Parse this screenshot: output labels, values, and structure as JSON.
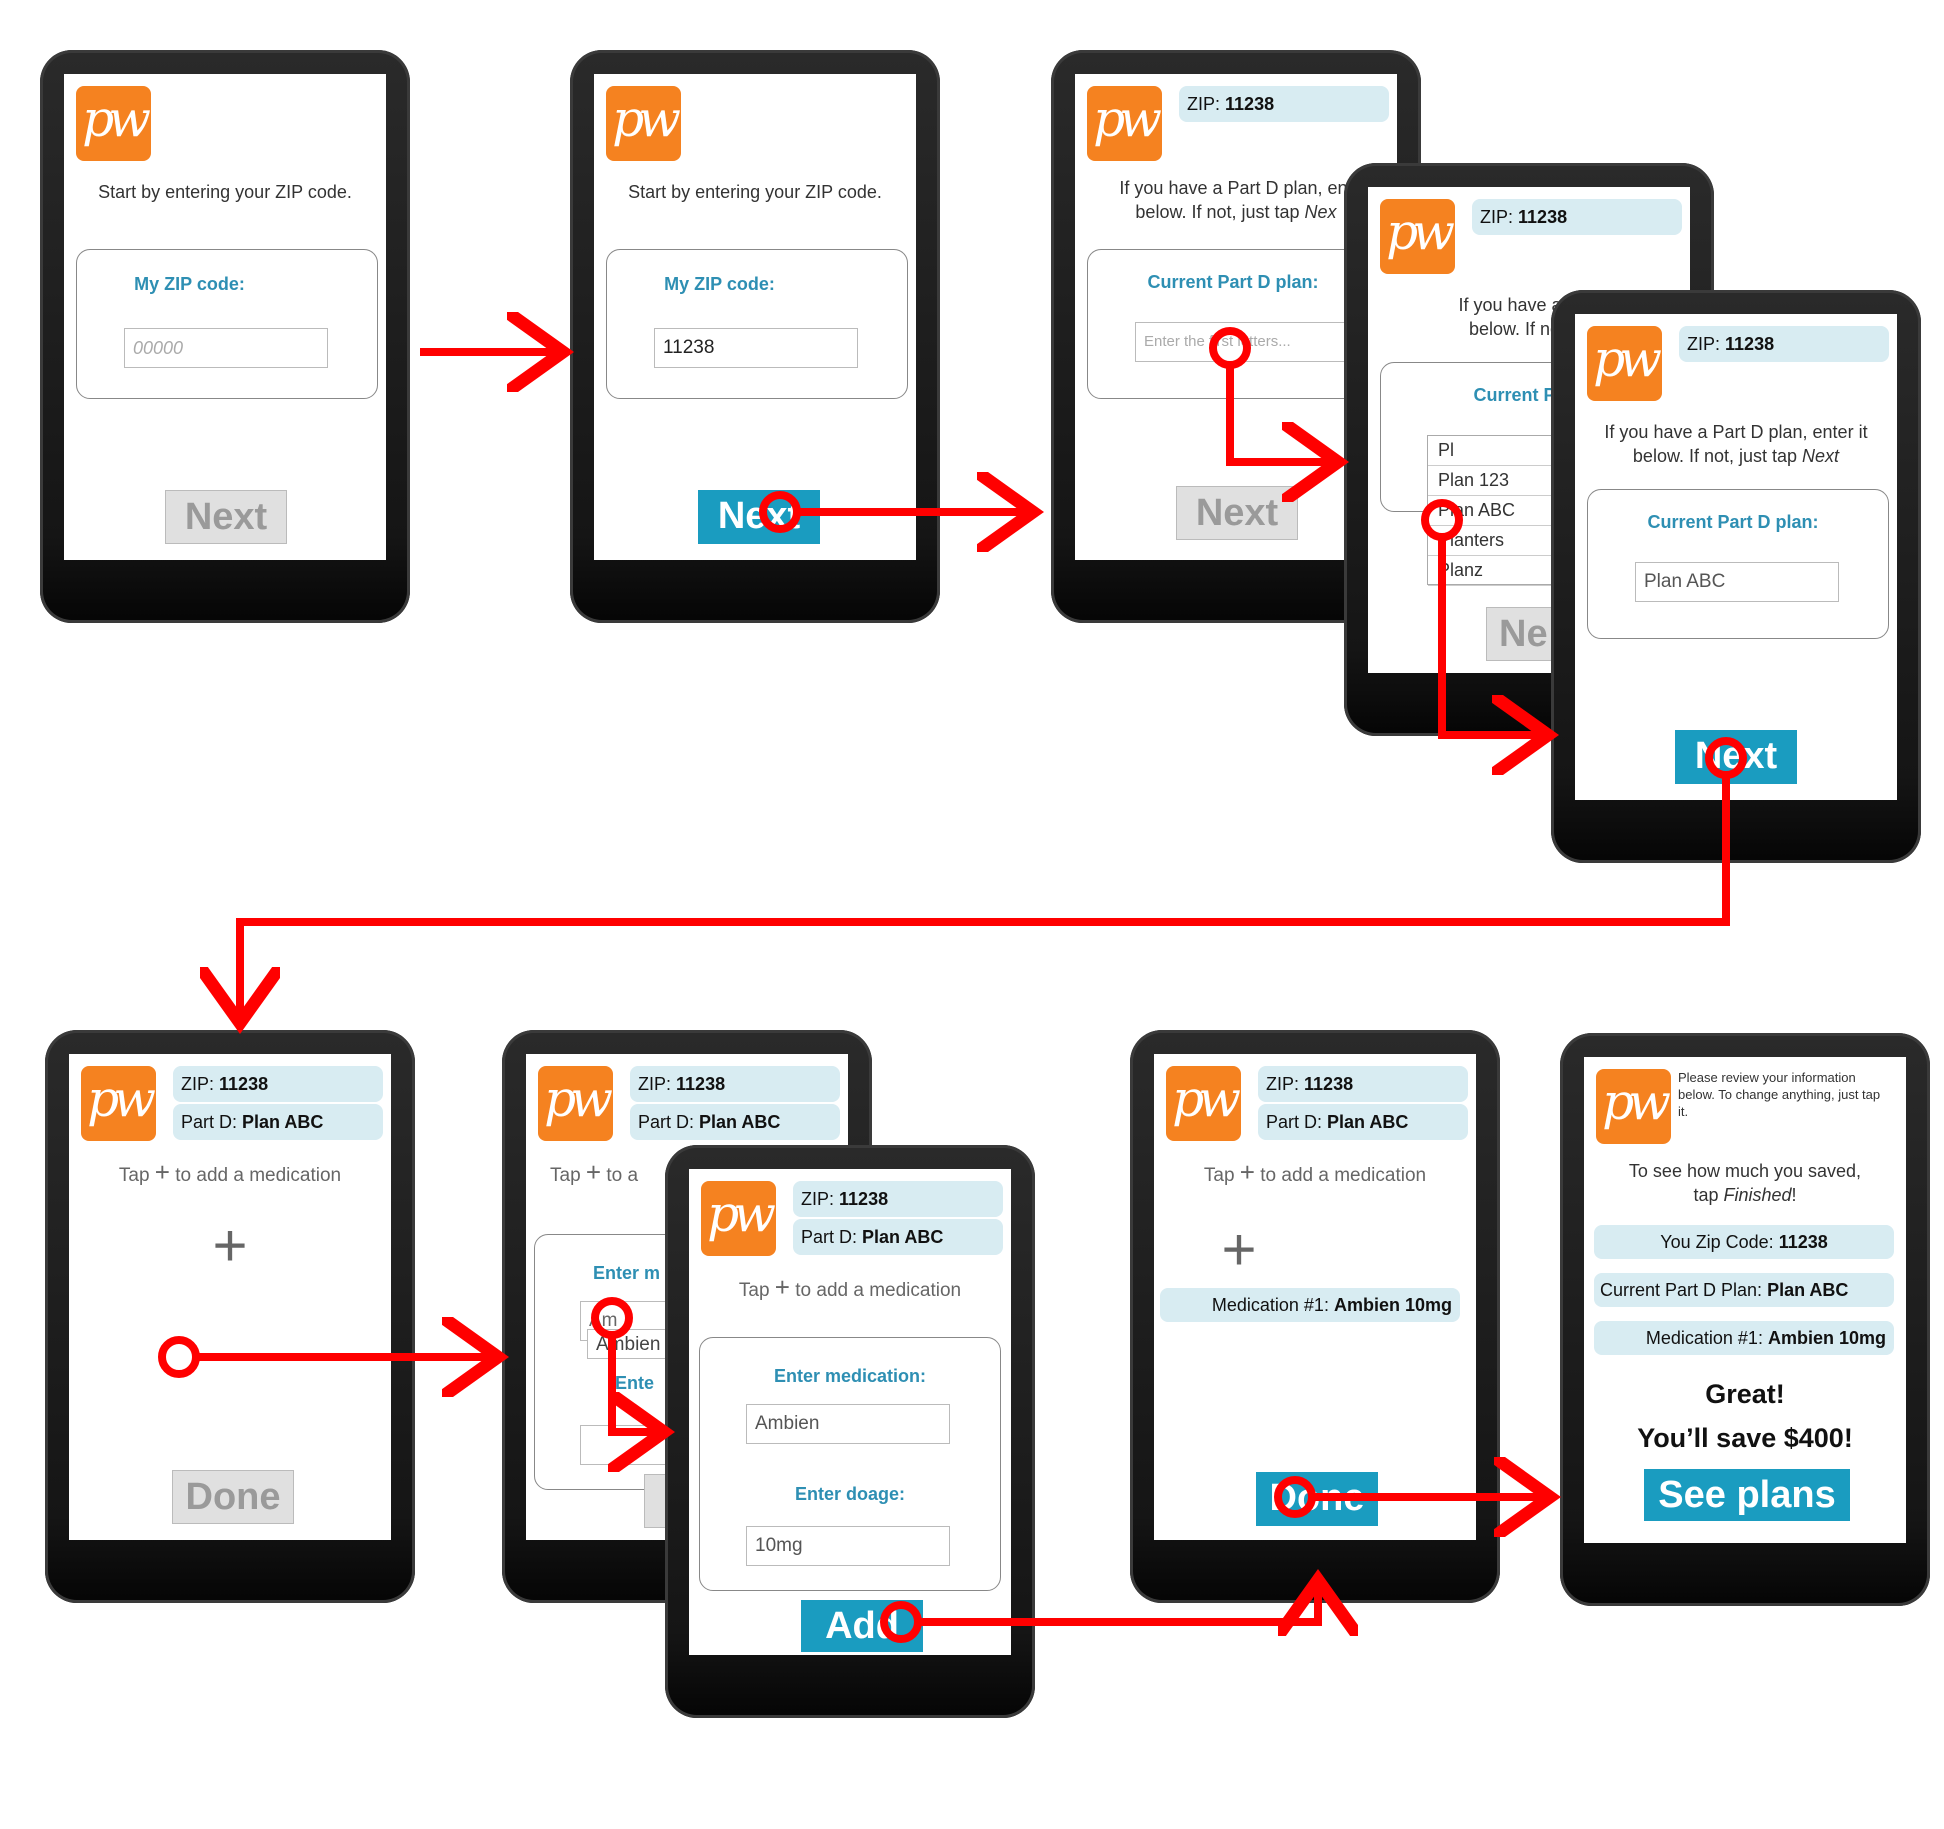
{
  "logo_text": "pw",
  "colors": {
    "accent": "#1a9cc0",
    "logo": "#f58220",
    "arrow": "#ff0000",
    "label": "#2e8fb3"
  },
  "s1": {
    "intro": "Start by entering your ZIP code.",
    "label": "My ZIP code:",
    "placeholder": "00000",
    "button": "Next"
  },
  "s2": {
    "intro": "Start by entering your ZIP code.",
    "label": "My ZIP code:",
    "value": "11238",
    "button": "Next"
  },
  "s3": {
    "zip_label": "ZIP:",
    "zip": "11238",
    "intro_line1": "If you have a Part D plan, ent",
    "intro_line2": "below. If not, just tap",
    "intro_next": "Nex",
    "label": "Current Part D plan:",
    "placeholder": "Enter the first letters...",
    "button": "Next"
  },
  "s4": {
    "zip_label": "ZIP:",
    "zip": "11238",
    "intro_line1": "If you have a Part",
    "intro_line2": "below. If not, ju",
    "label": "Current Part",
    "options": [
      "Pl",
      "Plan 123",
      "Plan ABC",
      "Planters",
      "Planz"
    ],
    "button": "Ne"
  },
  "s5": {
    "zip_label": "ZIP:",
    "zip": "11238",
    "intro_line1": "If you have a Part D plan, enter it",
    "intro_line2": "below. If not, just tap",
    "intro_next": "Next",
    "label": "Current Part D plan:",
    "value": "Plan ABC",
    "button": "Next"
  },
  "s6": {
    "zip_label": "ZIP:",
    "zip": "11238",
    "partd_label": "Part D:",
    "partd": "Plan ABC",
    "hint_pre": "Tap",
    "hint_post": "to add a medication",
    "plus": "+",
    "button": "Done"
  },
  "s7": {
    "zip_label": "ZIP:",
    "zip": "11238",
    "partd_label": "Part D:",
    "partd": "Plan ABC",
    "hint_pre": "Tap",
    "hint_post": "to a",
    "label": "Enter m",
    "input1": "Am",
    "option": "Ambien",
    "label2": "Ente"
  },
  "s8": {
    "zip_label": "ZIP:",
    "zip": "11238",
    "partd_label": "Part D:",
    "partd": "Plan ABC",
    "hint_pre": "Tap",
    "hint_post": "to add a medication",
    "label_med": "Enter medication:",
    "med": "Ambien",
    "label_dose": "Enter doage:",
    "dose": "10mg",
    "button": "Add"
  },
  "s9": {
    "zip_label": "ZIP:",
    "zip": "11238",
    "partd_label": "Part D:",
    "partd": "Plan ABC",
    "hint_pre": "Tap",
    "hint_post": "to add a medication",
    "plus": "+",
    "med_label": "Medication #1:",
    "med": "Ambien 10mg",
    "button": "Done"
  },
  "s10": {
    "review": "Please review your information below. To change anything, just tap it.",
    "saved_line1": "To see how much you saved,",
    "saved_line2": "tap",
    "saved_finished": "Finished",
    "saved_end": "!",
    "zip_label": "You Zip Code:",
    "zip": "11238",
    "partd_label": "Current Part D Plan:",
    "partd": "Plan ABC",
    "med_label": "Medication #1:",
    "med": "Ambien 10mg",
    "great": "Great!",
    "save": "You’ll save $400!",
    "button": "See plans"
  }
}
